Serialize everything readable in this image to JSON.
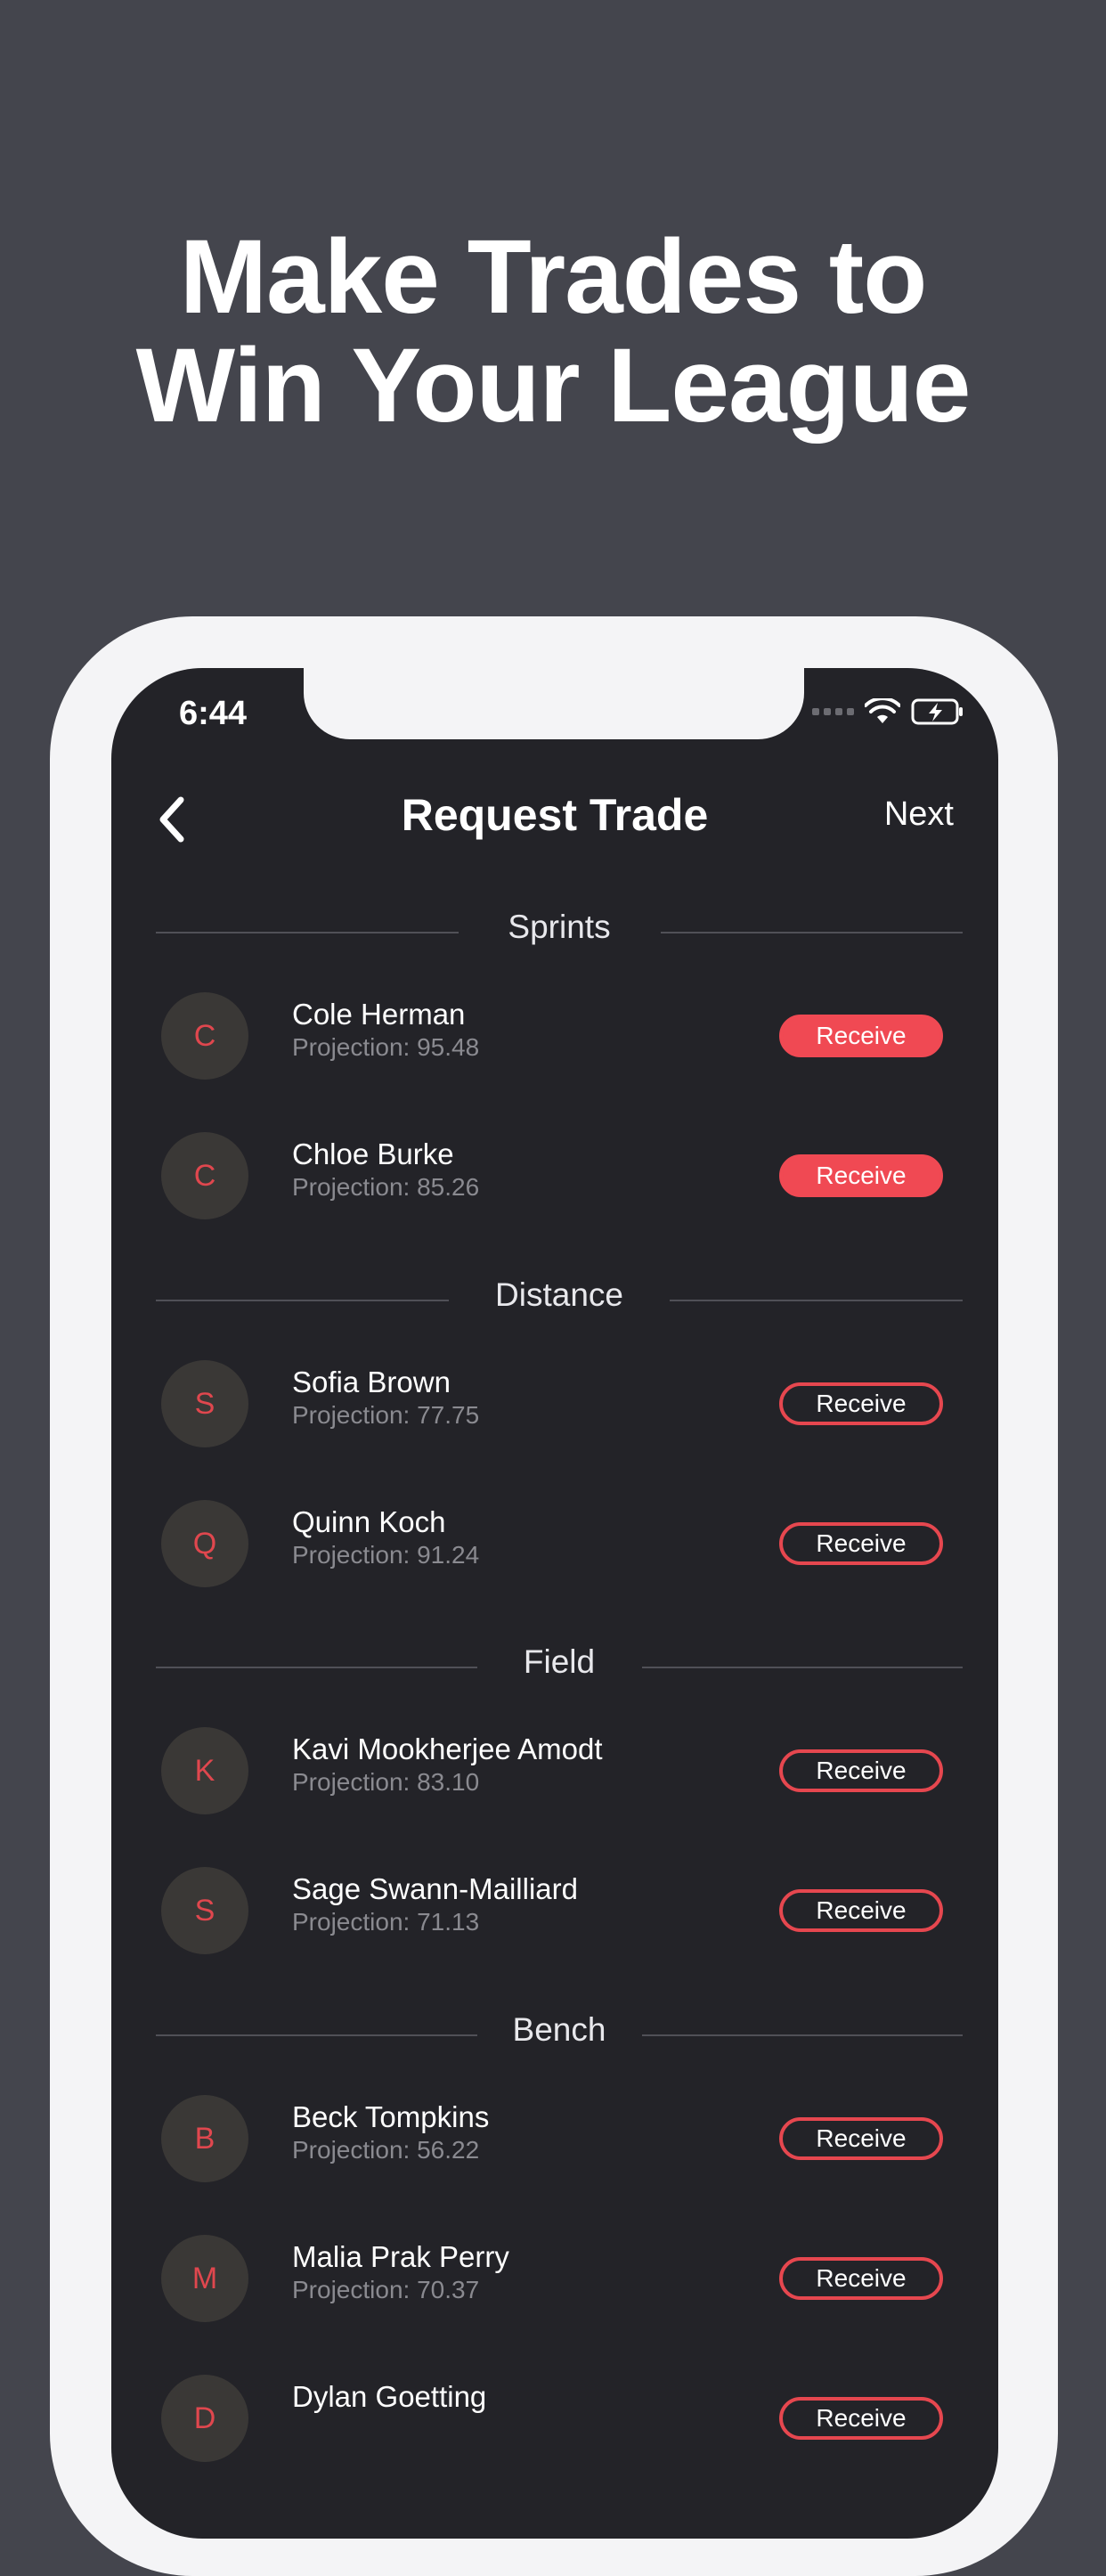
{
  "headline": {
    "line1": "Make Trades to",
    "line2": "Win Your League"
  },
  "status_bar": {
    "time": "6:44",
    "icons": [
      "signal-icon",
      "wifi-icon",
      "battery-charging-icon"
    ]
  },
  "nav": {
    "back_icon": "chevron-left-icon",
    "title": "Request Trade",
    "next_label": "Next"
  },
  "sections": [
    {
      "title": "Sprints",
      "players": [
        {
          "initial": "C",
          "name": "Cole Herman",
          "projection": "Projection: 95.48",
          "action": "Receive",
          "selected": true
        },
        {
          "initial": "C",
          "name": "Chloe Burke",
          "projection": "Projection: 85.26",
          "action": "Receive",
          "selected": true
        }
      ]
    },
    {
      "title": "Distance",
      "players": [
        {
          "initial": "S",
          "name": "Sofia Brown",
          "projection": "Projection: 77.75",
          "action": "Receive",
          "selected": false
        },
        {
          "initial": "Q",
          "name": "Quinn Koch",
          "projection": "Projection: 91.24",
          "action": "Receive",
          "selected": false
        }
      ]
    },
    {
      "title": "Field",
      "players": [
        {
          "initial": "K",
          "name": "Kavi Mookherjee Amodt",
          "projection": "Projection: 83.10",
          "action": "Receive",
          "selected": false
        },
        {
          "initial": "S",
          "name": "Sage Swann-Mailliard",
          "projection": "Projection: 71.13",
          "action": "Receive",
          "selected": false
        }
      ]
    },
    {
      "title": "Bench",
      "players": [
        {
          "initial": "B",
          "name": "Beck Tompkins",
          "projection": "Projection: 56.22",
          "action": "Receive",
          "selected": false
        },
        {
          "initial": "M",
          "name": "Malia Prak Perry",
          "projection": "Projection: 70.37",
          "action": "Receive",
          "selected": false
        },
        {
          "initial": "D",
          "name": "Dylan Goetting",
          "projection": "",
          "action": "Receive",
          "selected": false
        }
      ]
    }
  ],
  "colors": {
    "accent": "#f04953",
    "background": "#44454d",
    "screen": "#232328",
    "avatar": "#3a3836"
  }
}
